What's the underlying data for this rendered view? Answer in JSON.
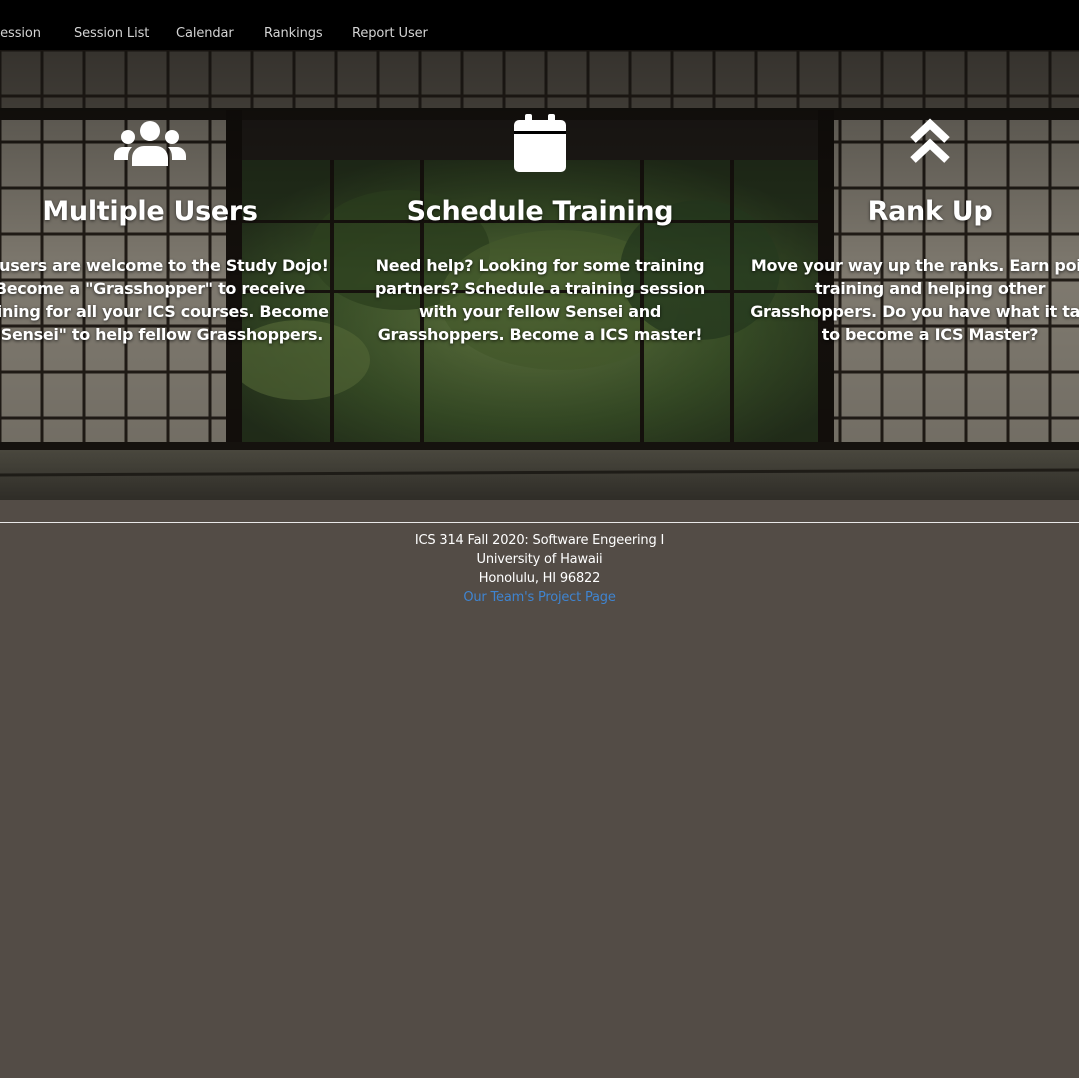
{
  "nav": {
    "items": [
      {
        "label": "Session"
      },
      {
        "label": "Session List"
      },
      {
        "label": "Calendar"
      },
      {
        "label": "Rankings"
      },
      {
        "label": "Report User"
      }
    ]
  },
  "features": [
    {
      "icon": "users-icon",
      "title": "Multiple Users",
      "description": "All users are welcome to the Study Dojo! Become a \"Grasshopper\" to receive training for all your ICS courses. Become a \"Sensei\" to help fellow Grasshoppers."
    },
    {
      "icon": "calendar-icon",
      "title": "Schedule Training",
      "description": "Need help? Looking for some training partners? Schedule a training session with your fellow Sensei and Grasshoppers. Become a ICS master!"
    },
    {
      "icon": "chevron-double-up-icon",
      "title": "Rank Up",
      "description": "Move your way up the ranks. Earn points training and helping other Grasshoppers. Do you have what it takes to become a ICS Master?"
    }
  ],
  "footer": {
    "line1": "ICS 314 Fall 2020: Software Engeering I",
    "line2": "University of Hawaii",
    "line3": "Honolulu, HI 96822",
    "link": "Our Team's Project Page"
  },
  "colors": {
    "navbar": "#000000",
    "page_background": "#534c46",
    "link": "#3f84d0"
  }
}
